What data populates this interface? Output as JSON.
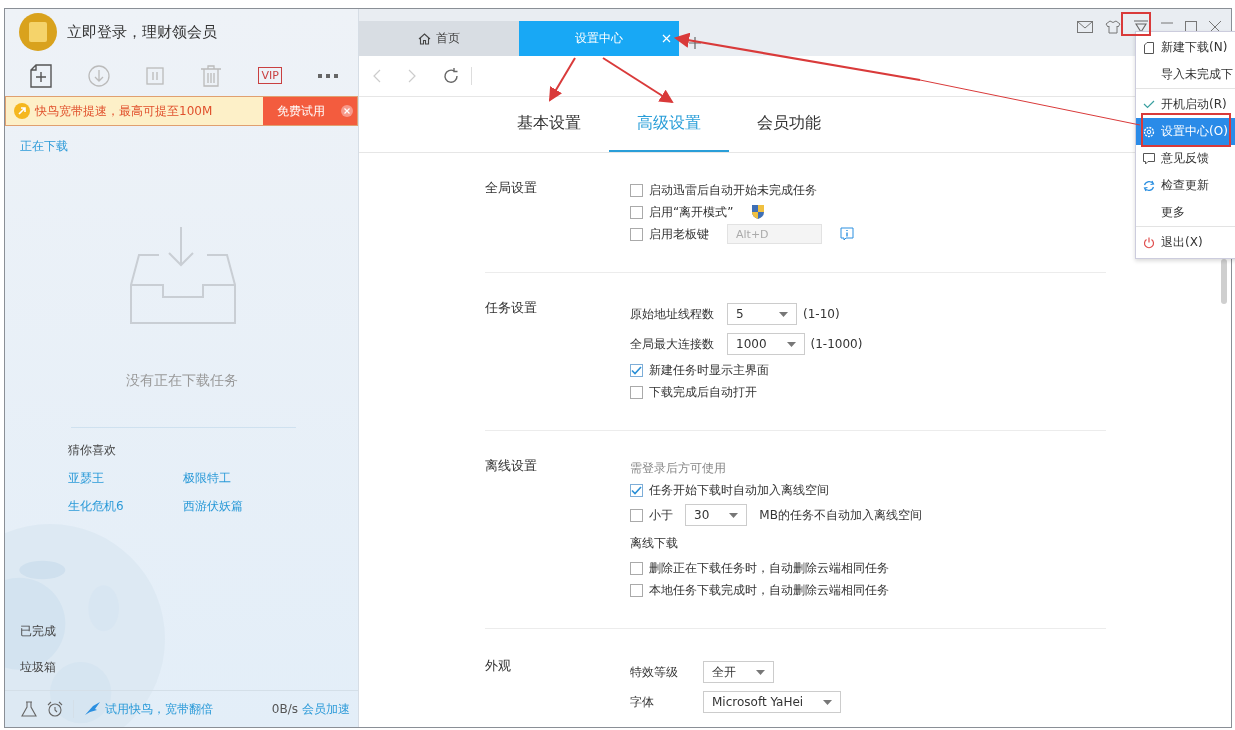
{
  "account": {
    "text": "立即登录，理财领会员"
  },
  "toolbar": {
    "vip_label": "VIP"
  },
  "promo": {
    "text": "快鸟宽带提速，最高可提至100M",
    "button": "免费试用"
  },
  "sidebar": {
    "downloading": "正在下载",
    "empty": "没有正在下载任务",
    "recommend_title": "猜你喜欢",
    "recommendations": [
      "亚瑟王",
      "极限特工",
      "生化危机6",
      "西游伏妖篇"
    ],
    "completed": "已完成",
    "trash": "垃圾箱"
  },
  "footer": {
    "promo": "试用快鸟，宽带翻倍",
    "speed": "0B/s",
    "boost": "会员加速"
  },
  "browser_tabs": [
    {
      "label": "首页",
      "selected": false
    },
    {
      "label": "设置中心",
      "selected": true
    }
  ],
  "settings_tabs": [
    {
      "label": "基本设置",
      "selected": false
    },
    {
      "label": "高级设置",
      "selected": true
    },
    {
      "label": "会员功能",
      "selected": false
    }
  ],
  "sections": [
    {
      "title": "全局设置",
      "rows": [
        {
          "kind": "checkbox",
          "label": "启动迅雷后自动开始未完成任务",
          "checked": false
        },
        {
          "kind": "shield",
          "label": "启用“离开模式”",
          "checked": false
        },
        {
          "kind": "hotkey",
          "label": "启用老板键",
          "checked": false,
          "placeholder": "Alt+D"
        }
      ]
    },
    {
      "title": "任务设置",
      "rows": [
        {
          "kind": "select",
          "label": "原始地址线程数",
          "value": "5",
          "range": "(1-10)"
        },
        {
          "kind": "select",
          "label": "全局最大连接数",
          "value": "1000",
          "range": "(1-1000)"
        },
        {
          "kind": "checkbox",
          "label": "新建任务时显示主界面",
          "checked": true
        },
        {
          "kind": "checkbox",
          "label": "下载完成后自动打开",
          "checked": false
        }
      ]
    },
    {
      "title": "离线设置",
      "rows": [
        {
          "kind": "note",
          "label": "需登录后方可使用"
        },
        {
          "kind": "checkbox",
          "label": "任务开始下载时自动加入离线空间",
          "checked": true
        },
        {
          "kind": "threshold",
          "label": "小于",
          "checked": false,
          "value": "30",
          "suffix": "MB的任务不自动加入离线空间"
        },
        {
          "kind": "subheading",
          "label": "离线下载"
        },
        {
          "kind": "checkbox",
          "label": "删除正在下载任务时，自动删除云端相同任务",
          "checked": false
        },
        {
          "kind": "checkbox",
          "label": "本地任务下载完成时，自动删除云端相同任务",
          "checked": false
        }
      ]
    },
    {
      "title": "外观",
      "rows": [
        {
          "kind": "select",
          "label": "特效等级",
          "value": "全开"
        },
        {
          "kind": "select",
          "label": "字体",
          "value": "Microsoft YaHei"
        }
      ]
    }
  ],
  "menu": [
    {
      "kind": "new",
      "label": "新建下载(N)",
      "selected": false,
      "separator_after": false
    },
    {
      "kind": "plain",
      "label": "导入未完成下",
      "selected": false,
      "separator_after": true
    },
    {
      "kind": "toggle",
      "label": "开机启动(R)",
      "selected": false,
      "checked": true,
      "separator_after": false
    },
    {
      "kind": "settings",
      "label": "设置中心(O)",
      "selected": true,
      "separator_after": false
    },
    {
      "kind": "feedback",
      "label": "意见反馈",
      "selected": false,
      "separator_after": false
    },
    {
      "kind": "update",
      "label": "检查更新",
      "selected": false,
      "separator_after": false
    },
    {
      "kind": "plain",
      "label": "更多",
      "selected": false,
      "separator_after": true
    },
    {
      "kind": "exit",
      "label": "退出(X)",
      "selected": false,
      "separator_after": false
    }
  ]
}
